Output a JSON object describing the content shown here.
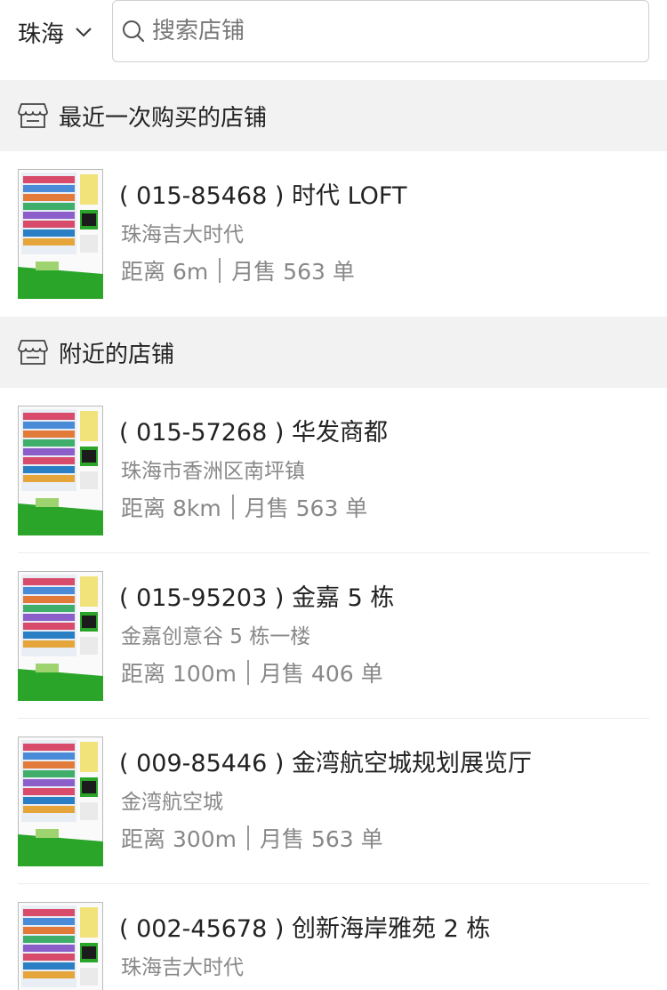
{
  "header": {
    "city": "珠海",
    "search_placeholder": "搜索店铺"
  },
  "sections": {
    "recent_title": "最近一次购买的店铺",
    "nearby_title": "附近的店铺"
  },
  "recent_store": {
    "title": "( 015-85468 ) 时代 LOFT",
    "address": "珠海吉大时代",
    "distance": "距离 6m",
    "sales": "月售 563 单"
  },
  "nearby_stores": [
    {
      "title": "( 015-57268 ) 华发商都",
      "address": "珠海市香洲区南坪镇",
      "distance": "距离 8km",
      "sales": "月售 563 单"
    },
    {
      "title": "( 015-95203 ) 金嘉 5 栋",
      "address": "金嘉创意谷 5 栋一楼",
      "distance": "距离 100m",
      "sales": "月售 406 单"
    },
    {
      "title": "( 009-85446 ) 金湾航空城规划展览厅",
      "address": "金湾航空城",
      "distance": "距离 300m",
      "sales": "月售 563 单"
    },
    {
      "title": "( 002-45678 ) 创新海岸雅苑 2 栋",
      "address": "珠海吉大时代",
      "distance": "",
      "sales": ""
    }
  ],
  "colors": {
    "accent_green": "#2aa52a",
    "section_bg": "#f2f2f2",
    "muted_text": "#888888"
  },
  "icons": [
    "chevron-down-icon",
    "search-icon",
    "shop-icon",
    "vending-machine-image"
  ]
}
